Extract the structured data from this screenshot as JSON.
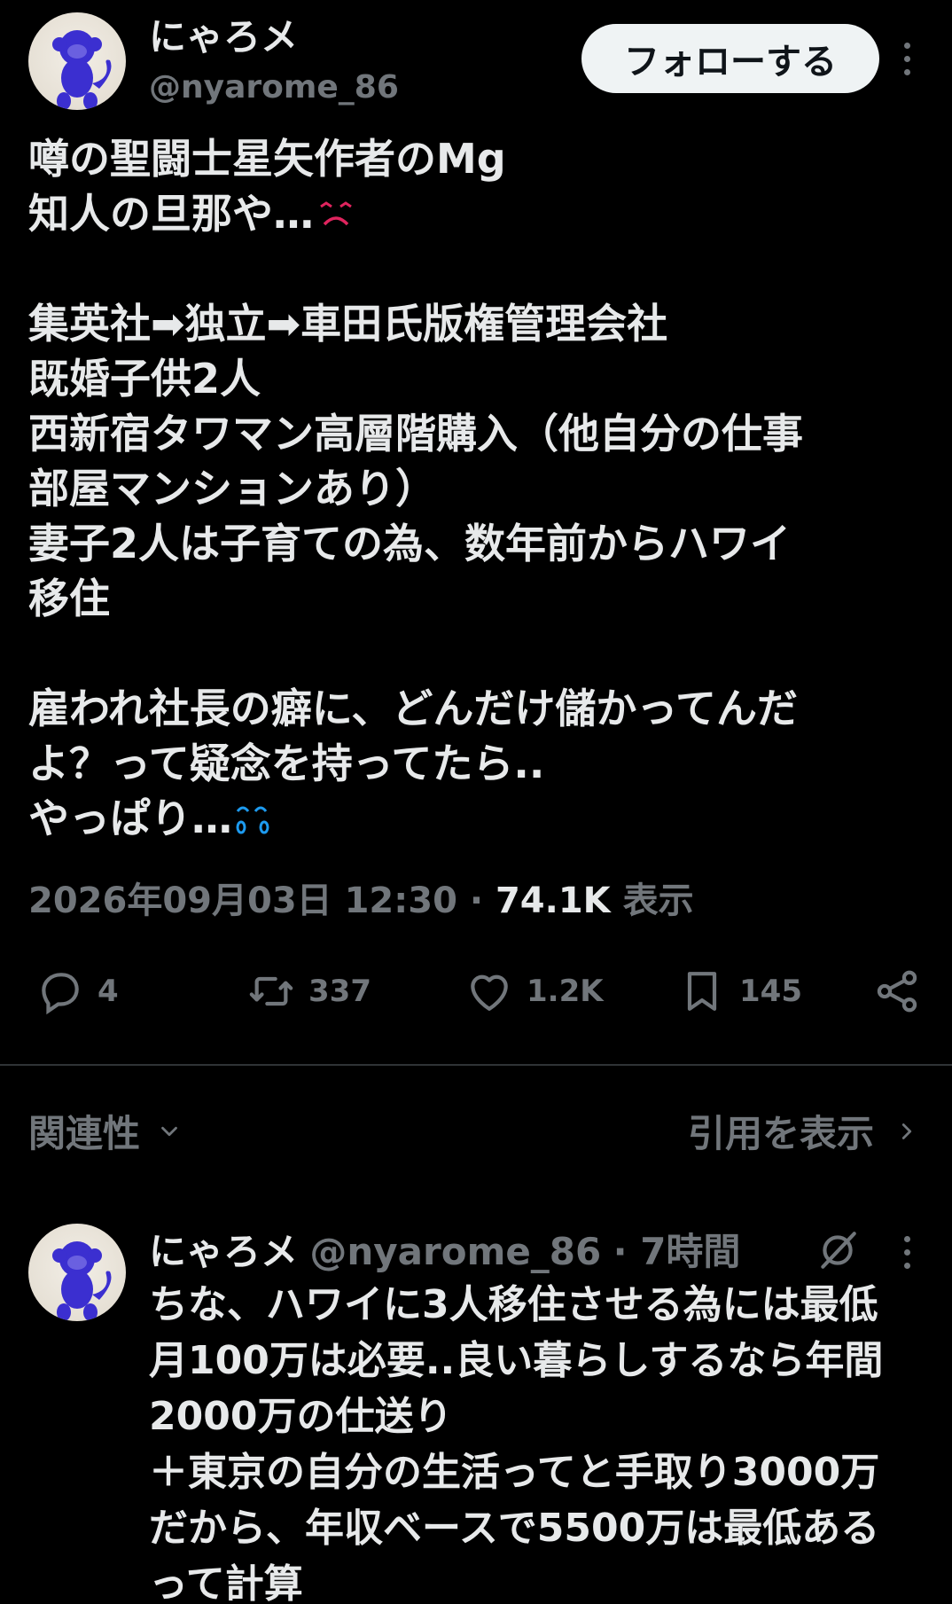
{
  "post": {
    "author_name": "にゃろメ",
    "author_handle": "@nyarome_86",
    "follow_label": "フォローする",
    "lines": [
      {
        "text": "噂の聖闘士星矢作者のMg",
        "emoji": ""
      },
      {
        "text": "知人の旦那や…",
        "emoji": "confounded-face"
      },
      {
        "text": "",
        "emoji": ""
      },
      {
        "text": "集英社➡独立➡車田氏版権管理会社",
        "emoji": ""
      },
      {
        "text": "既婚子供2人",
        "emoji": ""
      },
      {
        "text": "西新宿タワマン高層階購入（他自分の仕事",
        "emoji": ""
      },
      {
        "text": "部屋マンションあり）",
        "emoji": ""
      },
      {
        "text": "妻子2人は子育ての為、数年前からハワイ",
        "emoji": ""
      },
      {
        "text": "移住",
        "emoji": ""
      },
      {
        "text": "",
        "emoji": ""
      },
      {
        "text": "雇われ社長の癖に、どんだけ儲かってんだ",
        "emoji": ""
      },
      {
        "text": "よ？って疑念を持ってたら..",
        "emoji": ""
      },
      {
        "text": "やっぱり…",
        "emoji": "sweat-droplets"
      }
    ],
    "timestamp": "2026年09月03日 12:30",
    "separator": " · ",
    "views_count": "74.1K",
    "views_label": " 表示"
  },
  "actions": {
    "replies": "4",
    "reposts": "337",
    "likes": "1.2K",
    "bookmarks": "145"
  },
  "filter": {
    "sort_label": "関連性",
    "quotes_label": "引用を表示"
  },
  "reply": {
    "author_name": "にゃろメ",
    "author_handle": "@nyarome_86",
    "time": "· 7時間",
    "lines": [
      "ちな、ハワイに3人移住させる為には最低",
      "月100万は必要..良い暮らしするなら年間",
      "2000万の仕送り",
      "＋東京の自分の生活ってと手取り3000万",
      "だから、年収ベースで5500万は最低ある",
      "って計算"
    ]
  },
  "colors": {
    "background": "#000000",
    "text": "#e7e9ea",
    "muted": "#71767b",
    "divider": "#2f3336",
    "follow_bg": "#eff3f4",
    "avatar_figure": "#3b2fd0"
  }
}
